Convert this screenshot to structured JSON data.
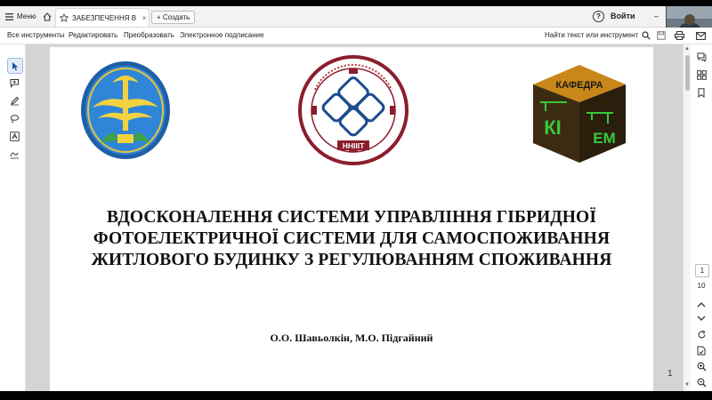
{
  "app": {
    "menu_label": "Меню",
    "tab_title": "ЗАБЕЗПЕЧЕННЯ ВІ...",
    "create_label": "Создать",
    "help_label": "?",
    "signin_label": "Войти",
    "minimize_label": "–"
  },
  "toolbar": {
    "items": [
      "Все инструменты",
      "Редактировать",
      "Преобразовать",
      "Электронное подписание"
    ],
    "search_label": "Найти текст или инструмент"
  },
  "document": {
    "title_lines": [
      "ВДОСКОНАЛЕННЯ СИСТЕМИ УПРАВЛІННЯ ГІБРИДНОЇ",
      "ФОТОЕЛЕКТРИЧНОЇ СИСТЕМИ ДЛЯ САМОСПОЖИВАННЯ",
      "ЖИТЛОВОГО БУДИНКУ З РЕГУЛЮВАННЯМ СПОЖИВАННЯ"
    ],
    "authors": "О.О. Шавьолкін, М.О. Підгайний",
    "page_number": "1",
    "logo_center_text": "ННІІІТ",
    "logo_center_ring": "НАВЧАЛЬНО-НАУКОВИЙ ІНСТИТУТ ІНЖЕНЕРІЇ ТА ІНФОРМАЦІЙНИХ ТЕХНОЛОГІЙ",
    "logo_right_top": "КАФЕДРА",
    "logo_right_face1": "КІ",
    "logo_right_face2": "ЕМ"
  },
  "navigation": {
    "current_page": "1",
    "total_pages": "10"
  },
  "colors": {
    "accent_blue": "#1a73e8",
    "logo_maroon": "#8b1e2d",
    "logo_green": "#2c8a2e",
    "logo_yellow": "#f0c419"
  }
}
